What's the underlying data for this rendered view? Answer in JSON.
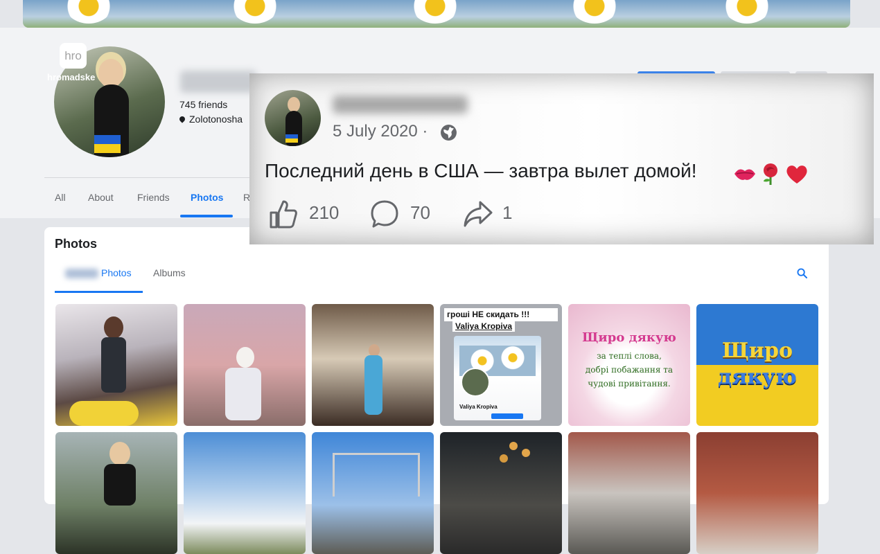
{
  "branding": {
    "logo_mark": "hro",
    "logo_name": "hromadske"
  },
  "profile": {
    "friends": "745 friends",
    "location": "Zolotonosha",
    "tabs": [
      {
        "label": "All"
      },
      {
        "label": "About"
      },
      {
        "label": "Friends"
      },
      {
        "label": "Photos",
        "active": true
      },
      {
        "label": "R"
      }
    ]
  },
  "photos_section": {
    "title": "Photos",
    "subtabs": [
      {
        "label": "Photos",
        "active": true
      },
      {
        "label": "Albums"
      }
    ],
    "tile_texts": {
      "t4_caption_line1": "гроші НЕ скидать !!!",
      "t4_caption_line2": "Valiya Kropiva",
      "t4_phone_name": "Valiya Kropiva",
      "t5_line1": "Щиро дякую",
      "t5_line2": "за теплі слова,",
      "t5_line3": "добрі побажання та",
      "t5_line4": "чудові привітання.",
      "t6_line1": "Щиро",
      "t6_line2": "дякую"
    }
  },
  "post_overlay": {
    "date": "5 July 2020 ·",
    "text": "Последний день в США — завтра вылет домой!",
    "emojis": [
      "kiss-mark-emoji",
      "rose-emoji",
      "red-heart-emoji"
    ],
    "likes": "210",
    "comments": "70",
    "shares": "1"
  },
  "colors": {
    "accent": "#1877f2",
    "text_primary": "#1c1e21",
    "text_secondary": "#65676b"
  },
  "icons": [
    "location-pin-icon",
    "search-icon",
    "globe-icon",
    "like-icon",
    "comment-icon",
    "share-icon"
  ]
}
